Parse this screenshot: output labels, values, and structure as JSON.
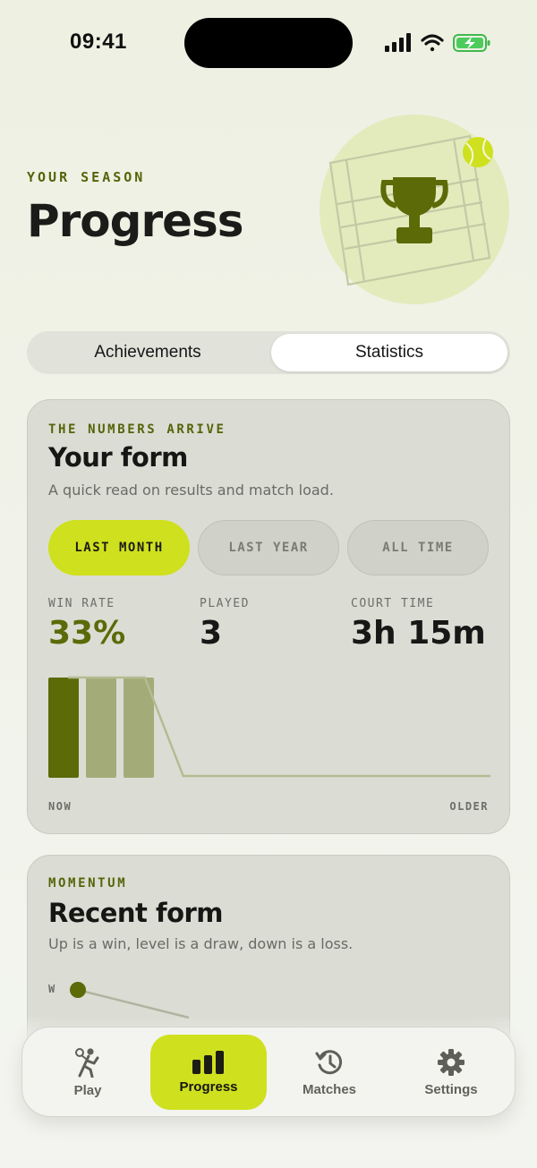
{
  "status_bar": {
    "time": "09:41"
  },
  "header": {
    "eyebrow": "YOUR SEASON",
    "title": "Progress",
    "hero_icon": "trophy-icon"
  },
  "tabs": [
    {
      "label": "Achievements",
      "selected": false
    },
    {
      "label": "Statistics",
      "selected": true
    }
  ],
  "form_card": {
    "eyebrow": "THE NUMBERS ARRIVE",
    "title": "Your form",
    "subtitle": "A quick read on results and match load.",
    "ranges": [
      {
        "label": "LAST MONTH",
        "selected": true
      },
      {
        "label": "LAST YEAR",
        "selected": false
      },
      {
        "label": "ALL TIME",
        "selected": false
      }
    ],
    "stats": [
      {
        "label": "WIN RATE",
        "value": "33%"
      },
      {
        "label": "PLAYED",
        "value": "3"
      },
      {
        "label": "COURT TIME",
        "value": "3h 15m"
      }
    ],
    "axis_start": "NOW",
    "axis_end": "OLDER"
  },
  "chart_data": {
    "type": "bar",
    "bars": [
      {
        "result": "win",
        "value": 1
      },
      {
        "result": "loss",
        "value": 1
      },
      {
        "result": "loss",
        "value": 1
      }
    ],
    "load_line": [
      1,
      1,
      1,
      0,
      0,
      0,
      0,
      0,
      0,
      0,
      0,
      0
    ],
    "colors": {
      "win": "#5c6a08",
      "loss": "#a3ab79",
      "line": "#b5bb92"
    }
  },
  "momentum_card": {
    "eyebrow": "MOMENTUM",
    "title": "Recent form",
    "subtitle": "Up is a win, level is a draw, down is a loss.",
    "y_label": "W"
  },
  "nav": [
    {
      "label": "Play",
      "icon": "tennis-player-icon",
      "active": false
    },
    {
      "label": "Progress",
      "icon": "bar-chart-icon",
      "active": true
    },
    {
      "label": "Matches",
      "icon": "history-icon",
      "active": false
    },
    {
      "label": "Settings",
      "icon": "gear-icon",
      "active": false
    }
  ],
  "colors": {
    "accent": "#cfe01f",
    "olive": "#5c6a08"
  }
}
